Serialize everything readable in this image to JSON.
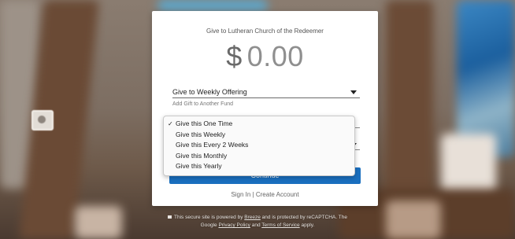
{
  "form": {
    "title": "Give to Lutheran Church of the Redeemer",
    "currency_symbol": "$",
    "amount": "0.00",
    "fund_selected": "Give to Weekly Offering",
    "add_fund_link": "Add Gift to Another Fund",
    "continue_label": "Continue",
    "sign_in": "Sign In",
    "separator": " | ",
    "create_account": "Create Account"
  },
  "frequency_menu": {
    "options": [
      {
        "label": "Give this One Time",
        "selected": true,
        "check": "✓"
      },
      {
        "label": "Give this Weekly",
        "selected": false
      },
      {
        "label": "Give this Every 2 Weeks",
        "selected": false
      },
      {
        "label": "Give this Monthly",
        "selected": false
      },
      {
        "label": "Give this Yearly",
        "selected": false
      }
    ]
  },
  "footer": {
    "line1_a": "This secure site is powered by ",
    "breeze": "Breeze",
    "line1_b": " and is protected by reCAPTCHA. The",
    "line2_a": "Google ",
    "privacy": "Privacy Policy",
    "line2_b": " and ",
    "terms": "Terms of Service",
    "line2_c": " apply."
  },
  "colors": {
    "accent": "#1a6fbf",
    "amount_text": "#8f8f8f"
  },
  "icons": [
    "caret-down-icon",
    "checkmark-icon",
    "lock-icon"
  ]
}
